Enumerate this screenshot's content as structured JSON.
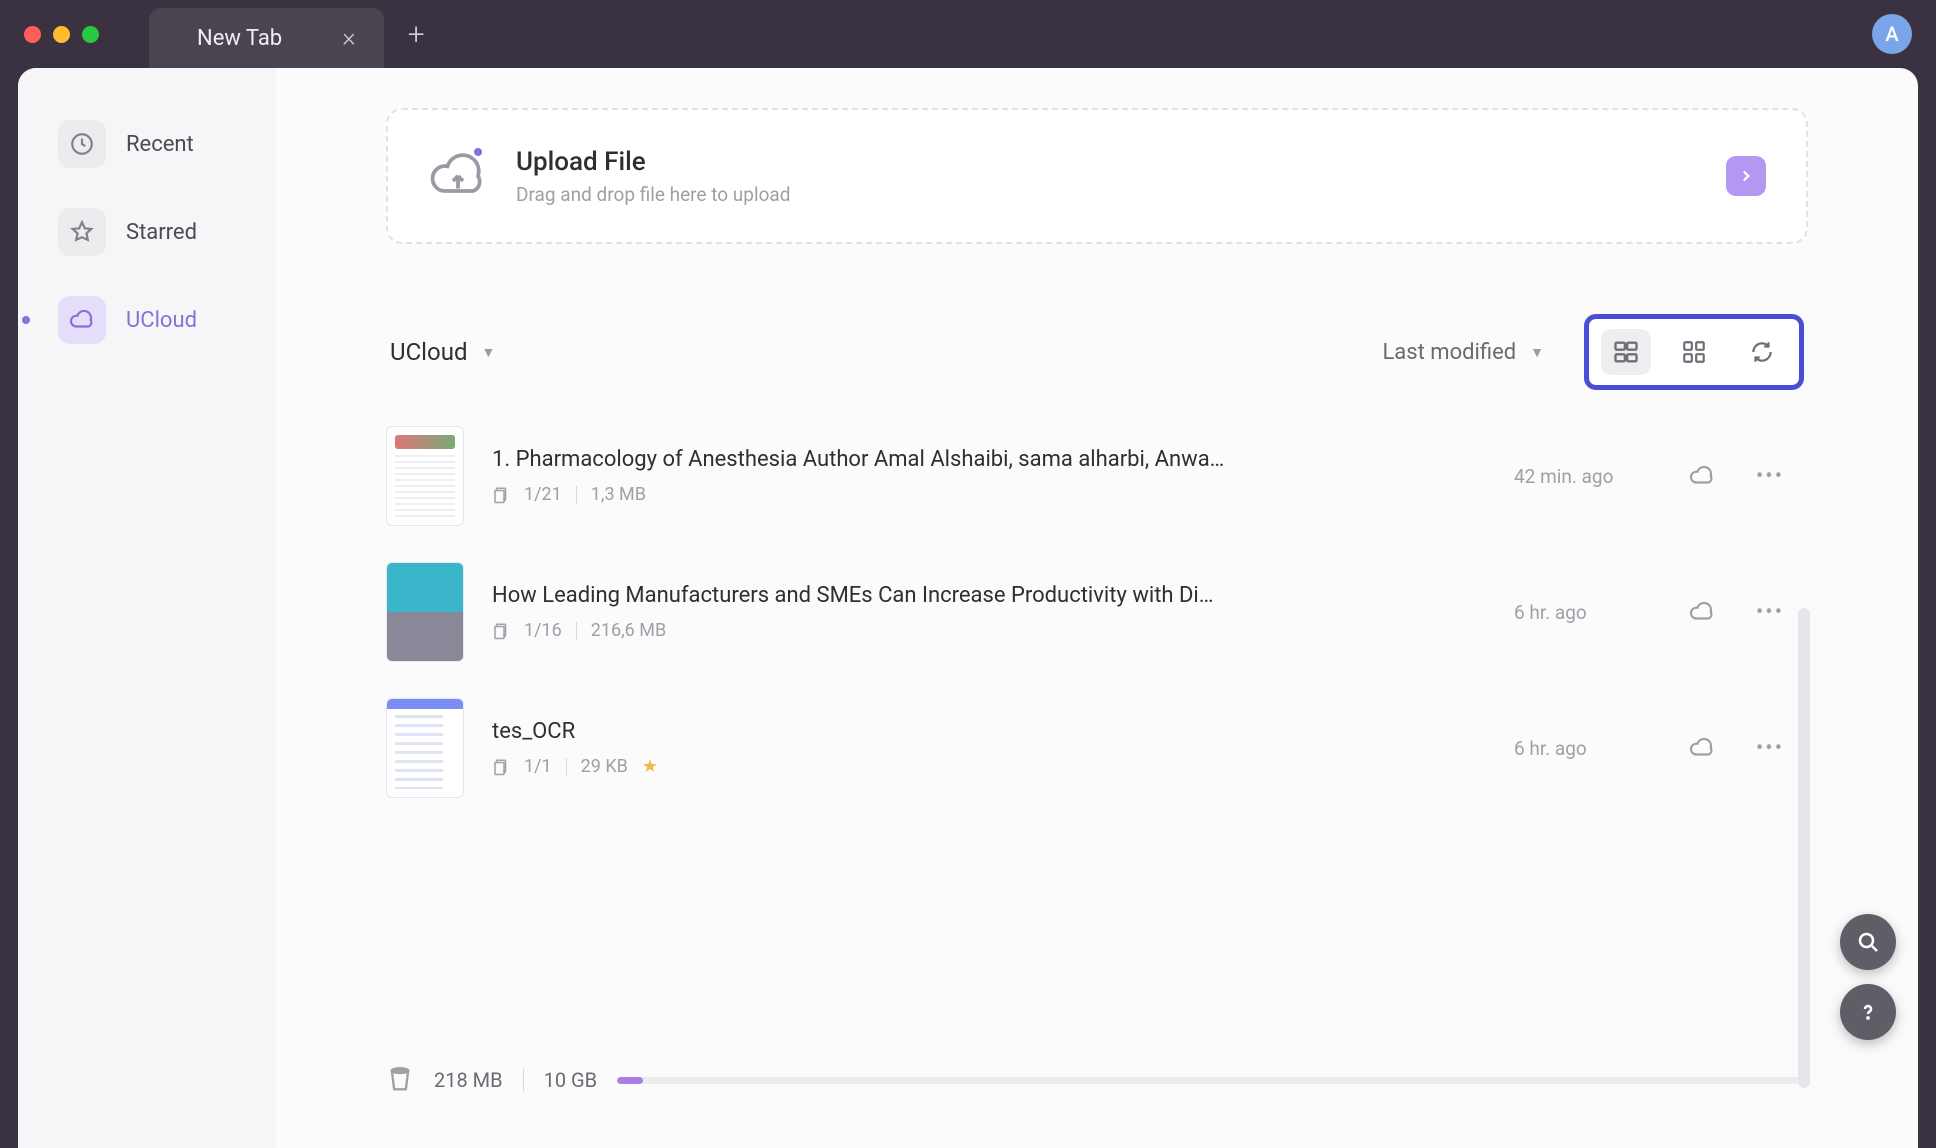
{
  "titlebar": {
    "tab_title": "New Tab",
    "avatar_initial": "A"
  },
  "sidebar": {
    "items": [
      {
        "label": "Recent",
        "icon": "clock-icon",
        "active": false
      },
      {
        "label": "Starred",
        "icon": "star-icon",
        "active": false
      },
      {
        "label": "UCloud",
        "icon": "cloud-icon",
        "active": true
      }
    ]
  },
  "upload": {
    "title": "Upload File",
    "subtitle": "Drag and drop file here to upload"
  },
  "controls": {
    "location_label": "UCloud",
    "sort_label": "Last modified"
  },
  "files": [
    {
      "name": "1. Pharmacology of Anesthesia Author Amal Alshaibi, sama alharbi, Anwa…",
      "pages": "1/21",
      "size": "1,3 MB",
      "time": "42 min. ago",
      "starred": false,
      "thumb": "doc1"
    },
    {
      "name": "How Leading Manufacturers and SMEs Can Increase Productivity with Di…",
      "pages": "1/16",
      "size": "216,6 MB",
      "time": "6 hr. ago",
      "starred": false,
      "thumb": "doc2"
    },
    {
      "name": "tes_OCR",
      "pages": "1/1",
      "size": "29 KB",
      "time": "6 hr. ago",
      "starred": true,
      "thumb": "doc3"
    }
  ],
  "storage": {
    "used": "218 MB",
    "total": "10 GB"
  }
}
